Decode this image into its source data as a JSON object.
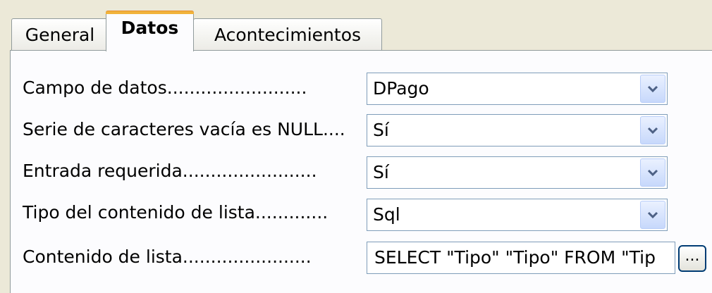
{
  "tabs": {
    "general": "General",
    "datos": "Datos",
    "acontecimientos": "Acontecimientos"
  },
  "fields": {
    "campo_de_datos": {
      "label": "Campo de datos.........................",
      "value": "DPago"
    },
    "serie_vacia_null": {
      "label": "Serie de caracteres vacía es NULL....",
      "value": "Sí"
    },
    "entrada_requerida": {
      "label": "Entrada requerida........................",
      "value": "Sí"
    },
    "tipo_contenido_lista": {
      "label": "Tipo del contenido de lista.............",
      "value": "Sql"
    },
    "contenido_lista": {
      "label": "Contenido de lista.......................",
      "value": "SELECT \"Tipo\" \"Tipo\" FROM \"Tip"
    }
  },
  "ellipsis_button": {
    "label": "..."
  },
  "icons": {
    "dropdown": "chevron-down-icon"
  },
  "colors": {
    "active_tab_accent": "#f1b33b",
    "dropdown_button": "#c7d8fb",
    "field_border": "#7f9db9"
  }
}
